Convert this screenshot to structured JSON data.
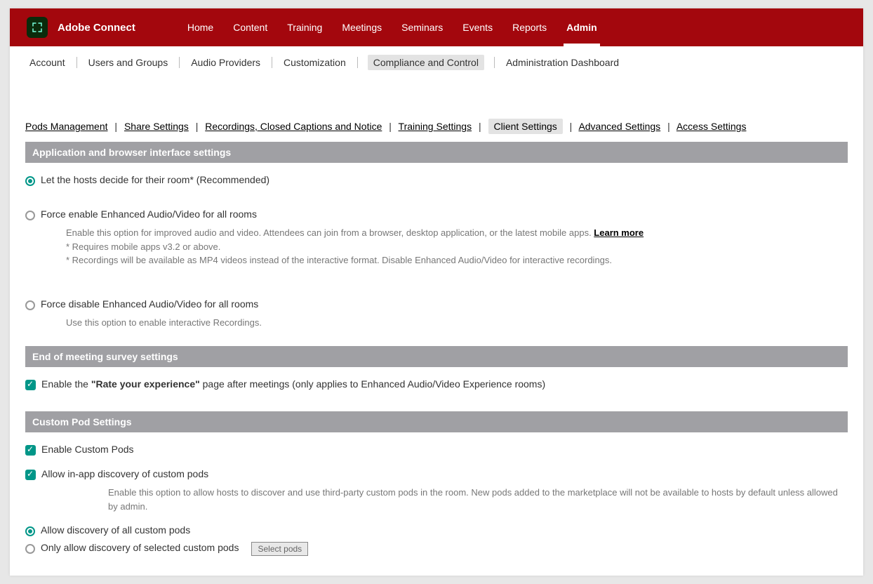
{
  "app": {
    "title": "Adobe Connect"
  },
  "nav": {
    "items": [
      {
        "label": "Home"
      },
      {
        "label": "Content"
      },
      {
        "label": "Training"
      },
      {
        "label": "Meetings"
      },
      {
        "label": "Seminars"
      },
      {
        "label": "Events"
      },
      {
        "label": "Reports"
      },
      {
        "label": "Admin"
      }
    ]
  },
  "subnav": {
    "items": [
      {
        "label": "Account"
      },
      {
        "label": "Users and Groups"
      },
      {
        "label": "Audio Providers"
      },
      {
        "label": "Customization"
      },
      {
        "label": "Compliance and Control"
      },
      {
        "label": "Administration Dashboard"
      }
    ]
  },
  "bc": {
    "items": [
      {
        "label": "Pods Management"
      },
      {
        "label": "Share Settings"
      },
      {
        "label": "Recordings, Closed Captions and Notice"
      },
      {
        "label": "Training Settings"
      },
      {
        "label": "Client Settings"
      },
      {
        "label": "Advanced Settings"
      },
      {
        "label": "Access Settings"
      }
    ]
  },
  "sections": {
    "s1": {
      "title": "Application and browser interface settings",
      "opt1": "Let the hosts decide for their room* (Recommended)",
      "opt2": "Force enable Enhanced Audio/Video for all rooms",
      "opt2_help": "Enable this option for improved audio and video. Attendees can join from a browser, desktop application, or the latest mobile apps. ",
      "opt2_learn": "Learn more",
      "opt2_note1": "* Requires mobile apps v3.2 or above.",
      "opt2_note2": "* Recordings will be available as MP4 videos instead of the interactive format. Disable Enhanced Audio/Video for interactive recordings.",
      "opt3": "Force disable Enhanced Audio/Video for all rooms",
      "opt3_help": "Use this option to enable interactive Recordings."
    },
    "s2": {
      "title": "End of meeting survey settings",
      "cb1_pre": "Enable the ",
      "cb1_bold": "\"Rate your experience\"",
      "cb1_post": " page after meetings (only applies to Enhanced Audio/Video Experience rooms)"
    },
    "s3": {
      "title": "Custom Pod Settings",
      "cb1": "Enable Custom Pods",
      "cb2": "Allow in-app discovery of custom pods",
      "cb2_help": "Enable this option to allow hosts to discover and use third-party custom pods in the room. New pods added to the marketplace will not be available to hosts by default unless allowed by admin.",
      "r1": "Allow discovery of all custom pods",
      "r2": "Only allow discovery of selected custom pods",
      "btn": "Select pods"
    }
  }
}
